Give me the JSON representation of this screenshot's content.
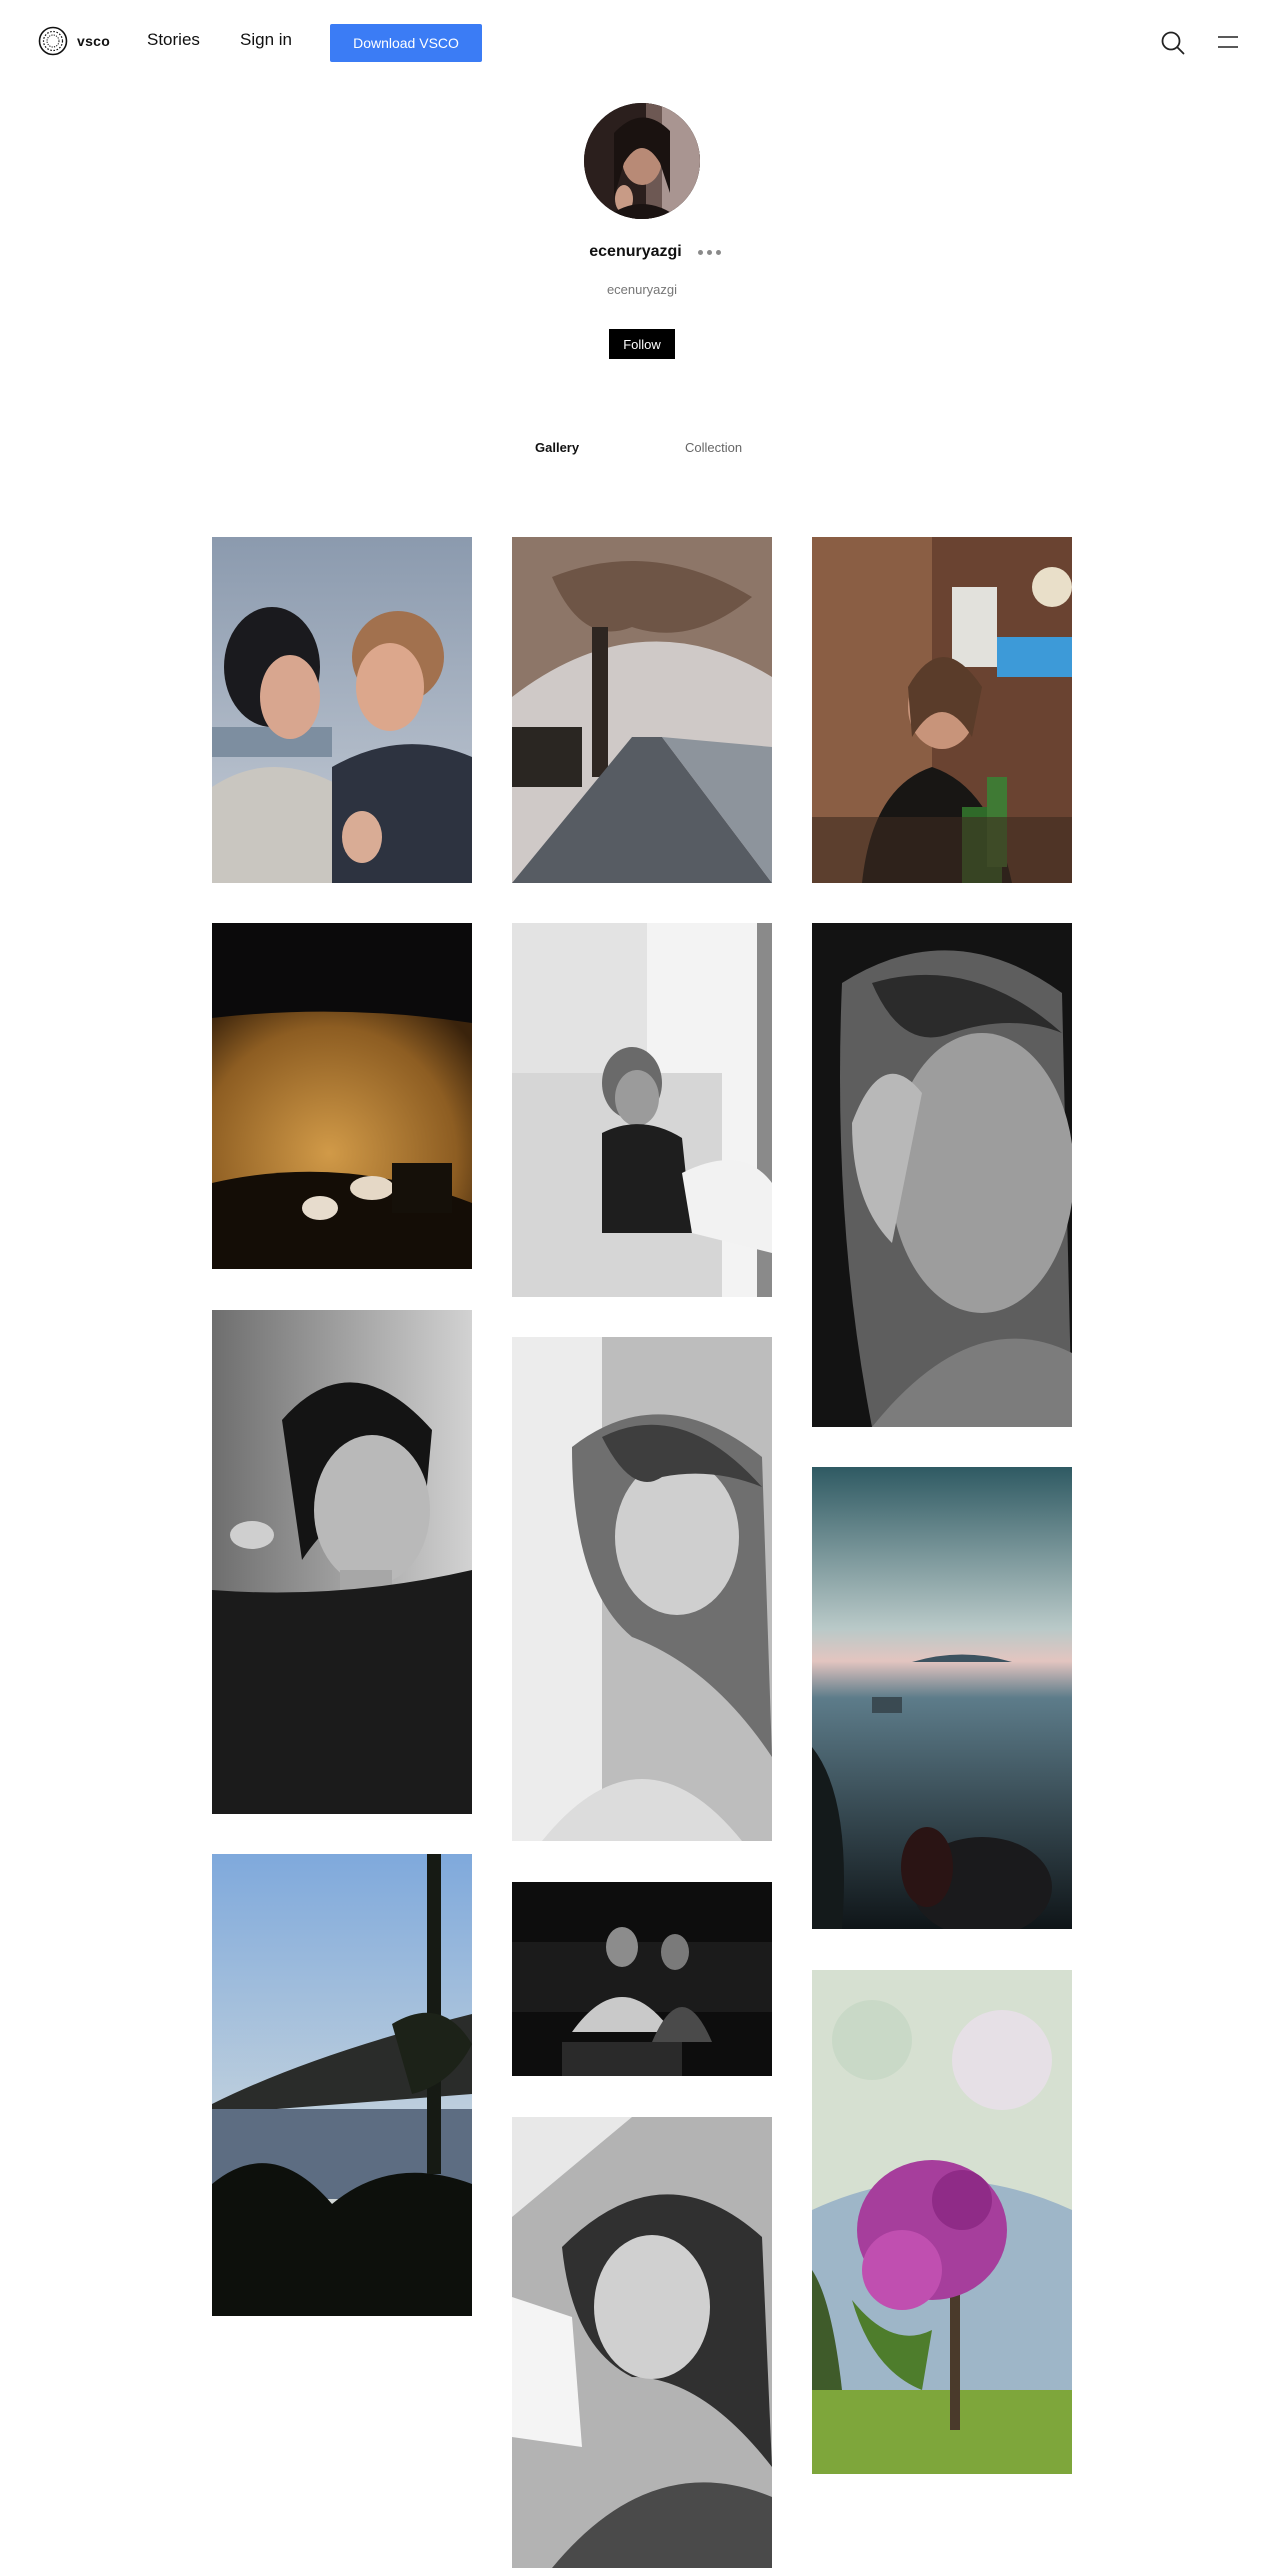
{
  "header": {
    "logo_text": "vsco",
    "nav": {
      "stories_label": "Stories",
      "signin_label": "Sign in"
    },
    "download_label": "Download VSCO",
    "icons": [
      "vsco-logo-icon",
      "search-icon",
      "menu-icon",
      "more-options-icon"
    ]
  },
  "profile": {
    "display_name": "ecenuryazgi",
    "handle": "ecenuryazgi",
    "follow_label": "Follow"
  },
  "tabs": {
    "gallery_label": "Gallery",
    "collection_label": "Collection",
    "active": "Gallery"
  },
  "colors": {
    "accent": "#3b7cf5",
    "follow_bg": "#000000",
    "text": "#111111",
    "muted": "#777777"
  }
}
